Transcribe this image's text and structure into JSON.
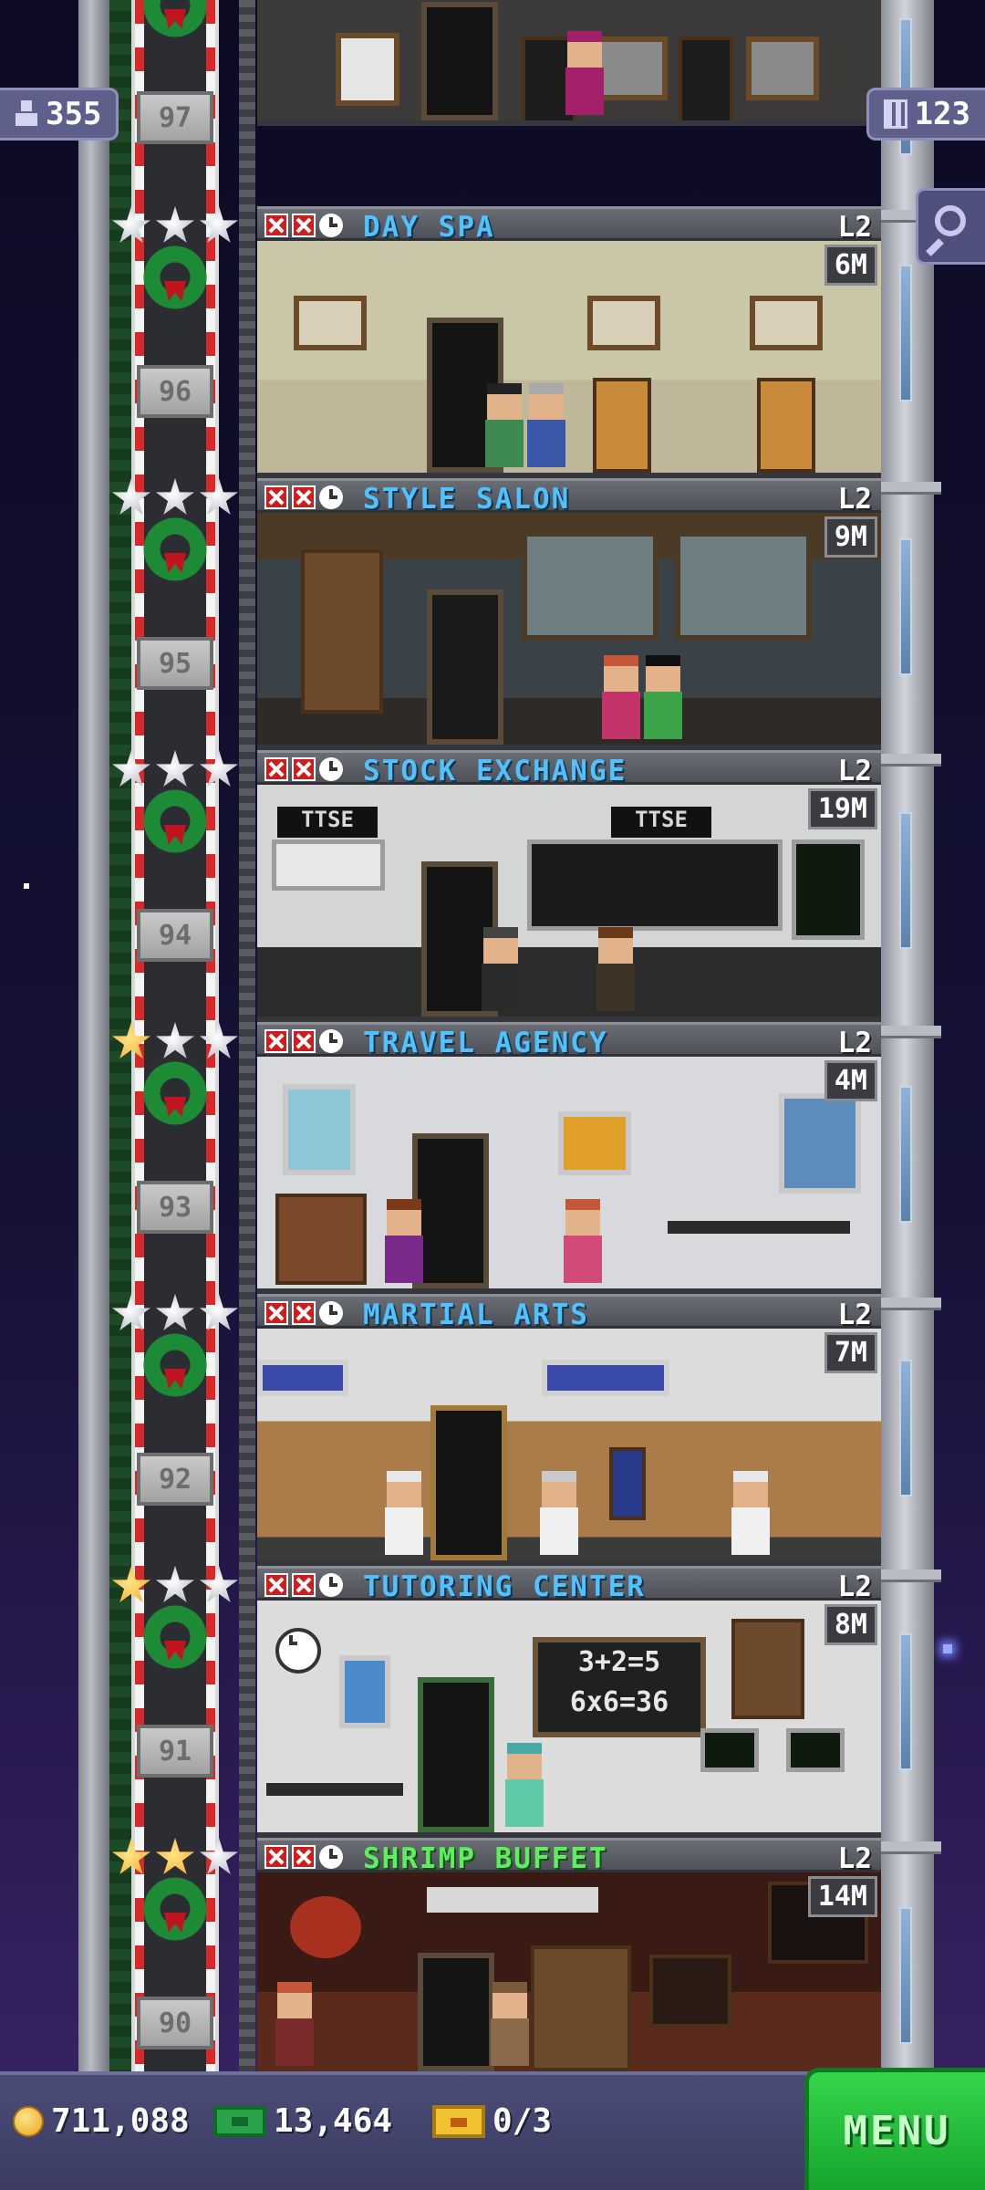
{
  "hud": {
    "population": "355",
    "floors_count": "123"
  },
  "top_floor": {
    "number": "97"
  },
  "floors": [
    {
      "number": "96",
      "name": "DAY SPA",
      "level": "L2",
      "stock": "6M",
      "stars": [
        "silver",
        "silver",
        "silver"
      ],
      "name_color": "blue"
    },
    {
      "number": "95",
      "name": "STYLE SALON",
      "level": "L2",
      "stock": "9M",
      "stars": [
        "silver",
        "silver",
        "silver"
      ],
      "name_color": "blue"
    },
    {
      "number": "94",
      "name": "STOCK EXCHANGE",
      "level": "L2",
      "stock": "19M",
      "stars": [
        "silver",
        "silver",
        "silver"
      ],
      "name_color": "blue",
      "signs": [
        "TTSE",
        "TTSE"
      ]
    },
    {
      "number": "93",
      "name": "TRAVEL AGENCY",
      "level": "L2",
      "stock": "4M",
      "stars": [
        "gold",
        "silver",
        "silver"
      ],
      "name_color": "blue"
    },
    {
      "number": "92",
      "name": "MARTIAL ARTS",
      "level": "L2",
      "stock": "7M",
      "stars": [
        "silver",
        "silver",
        "silver"
      ],
      "name_color": "blue"
    },
    {
      "number": "91",
      "name": "TUTORING CENTER",
      "level": "L2",
      "stock": "8M",
      "stars": [
        "gold",
        "silver",
        "silver"
      ],
      "name_color": "blue",
      "board_lines": [
        "3+2=5",
        "6x6=36"
      ]
    },
    {
      "number": "90",
      "name": "SHRIMP BUFFET",
      "level": "L2",
      "stock": "14M",
      "stars": [
        "gold",
        "gold",
        "silver"
      ],
      "name_color": "green"
    }
  ],
  "bottom_bar": {
    "coins": "711,088",
    "bux": "13,464",
    "tickets": "0/3",
    "menu_label": "MENU"
  },
  "colors": {
    "room_name_blue": "#4fc2ff",
    "room_name_green": "#5cf05c",
    "menu_green": "#16a52d",
    "hud_purple": "#5e5f8a"
  }
}
